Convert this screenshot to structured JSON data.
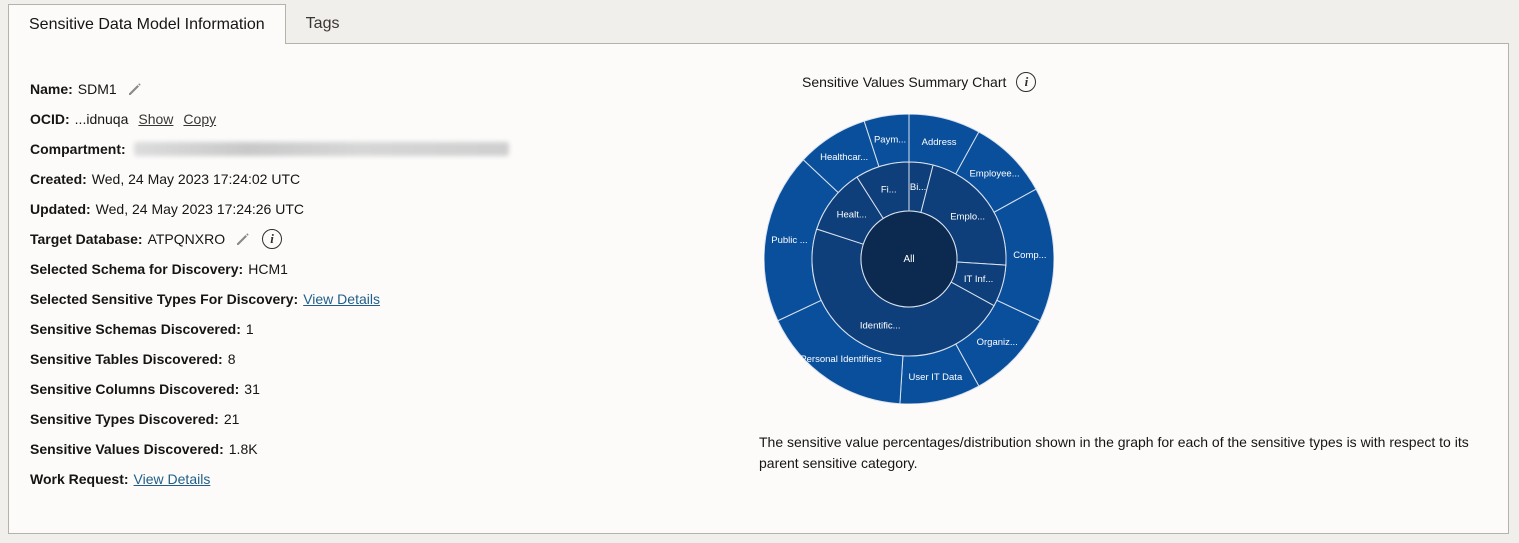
{
  "tabs": [
    {
      "label": "Sensitive Data Model Information",
      "active": true
    },
    {
      "label": "Tags",
      "active": false
    }
  ],
  "details": {
    "name_label": "Name:",
    "name_value": "SDM1",
    "ocid_label": "OCID:",
    "ocid_value": "...idnuqa",
    "ocid_show": "Show",
    "ocid_copy": "Copy",
    "compartment_label": "Compartment:",
    "created_label": "Created:",
    "created_value": "Wed, 24 May 2023 17:24:02 UTC",
    "updated_label": "Updated:",
    "updated_value": "Wed, 24 May 2023 17:24:26 UTC",
    "target_db_label": "Target Database:",
    "target_db_value": "ATPQNXRO",
    "schema_label": "Selected Schema for Discovery:",
    "schema_value": "HCM1",
    "types_label": "Selected Sensitive Types For Discovery:",
    "types_link": "View Details",
    "schemas_disc_label": "Sensitive Schemas Discovered:",
    "schemas_disc_value": "1",
    "tables_disc_label": "Sensitive Tables Discovered:",
    "tables_disc_value": "8",
    "columns_disc_label": "Sensitive Columns Discovered:",
    "columns_disc_value": "31",
    "types_disc_label": "Sensitive Types Discovered:",
    "types_disc_value": "21",
    "values_disc_label": "Sensitive Values Discovered:",
    "values_disc_value": "1.8K",
    "work_request_label": "Work Request:",
    "work_request_link": "View Details"
  },
  "chart": {
    "title": "Sensitive Values Summary Chart",
    "footnote": "The sensitive value percentages/distribution shown in the graph for each of the sensitive types is with respect to its parent sensitive category."
  },
  "colors": {
    "center": "#0c2a4f",
    "inner_ring": "#0f3f7a",
    "outer_ring": "#0a4f9c",
    "link": "#1f5e8a"
  },
  "chart_data": {
    "type": "sunburst",
    "center": "All",
    "inner": [
      {
        "label": "Bi...",
        "value": 4
      },
      {
        "label": "Emplo...",
        "value": 22
      },
      {
        "label": "IT Inf...",
        "value": 7
      },
      {
        "label": "Identific...",
        "value": 47
      },
      {
        "label": "Healt...",
        "value": 11
      },
      {
        "label": "Fi...",
        "value": 9
      }
    ],
    "outer": [
      {
        "label": "Address",
        "value": 8
      },
      {
        "label": "Employee...",
        "value": 9
      },
      {
        "label": "Comp...",
        "value": 15
      },
      {
        "label": "Organiz...",
        "value": 10
      },
      {
        "label": "User IT Data",
        "value": 9
      },
      {
        "label": "Personal Identifiers",
        "value": 17
      },
      {
        "label": "Public ...",
        "value": 19
      },
      {
        "label": "Healthcar...",
        "value": 8
      },
      {
        "label": "Paym...",
        "value": 5
      }
    ]
  }
}
